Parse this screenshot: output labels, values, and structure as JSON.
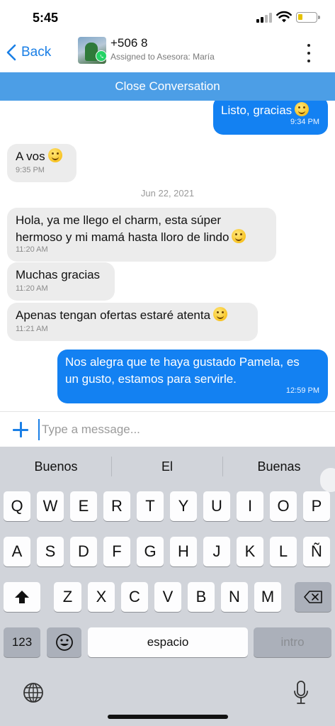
{
  "status": {
    "time": "5:45"
  },
  "header": {
    "back_label": "Back",
    "contact_name": "+506 8",
    "assigned": "Assigned to Asesora: María"
  },
  "close_bar": {
    "label": "Close Conversation"
  },
  "messages": [
    {
      "direction": "out",
      "text": "Listo, gracias",
      "emoji": "smiley",
      "time": "9:34 PM"
    },
    {
      "direction": "in",
      "text": "A vos",
      "emoji": "smiling-face",
      "time": "9:35 PM"
    },
    {
      "direction": "date",
      "text": "Jun 22, 2021"
    },
    {
      "direction": "in",
      "line1": "Hola, ya me llego el charm, esta súper",
      "line2": "hermoso y mi mamá hasta lloro de lindo",
      "emoji": "smiling-face",
      "time": "11:20 AM"
    },
    {
      "direction": "in",
      "text": "Muchas gracias",
      "time": "11:20 AM"
    },
    {
      "direction": "in",
      "text": "Apenas tengan ofertas estaré atenta",
      "emoji": "smiling-face",
      "time": "11:21 AM"
    },
    {
      "direction": "out",
      "line1": "Nos alegra que te haya gustado Pamela, es",
      "line2": "un gusto, estamos para servirle.",
      "time": "12:59 PM"
    }
  ],
  "composer": {
    "placeholder": "Type a message..."
  },
  "keyboard": {
    "suggestions": [
      "Buenos",
      "El",
      "Buenas"
    ],
    "row1": [
      "Q",
      "W",
      "E",
      "R",
      "T",
      "Y",
      "U",
      "I",
      "O",
      "P"
    ],
    "row2": [
      "A",
      "S",
      "D",
      "F",
      "G",
      "H",
      "J",
      "K",
      "L",
      "Ñ"
    ],
    "row3": [
      "Z",
      "X",
      "C",
      "V",
      "B",
      "N",
      "M"
    ],
    "numbers_label": "123",
    "space_label": "espacio",
    "return_label": "intro"
  },
  "colors": {
    "accent": "#1a7fe6",
    "close_bar": "#4c9ee6",
    "outgoing_bubble": "#1381f2",
    "incoming_bubble": "#ececec",
    "keyboard_bg": "#d1d4da"
  }
}
